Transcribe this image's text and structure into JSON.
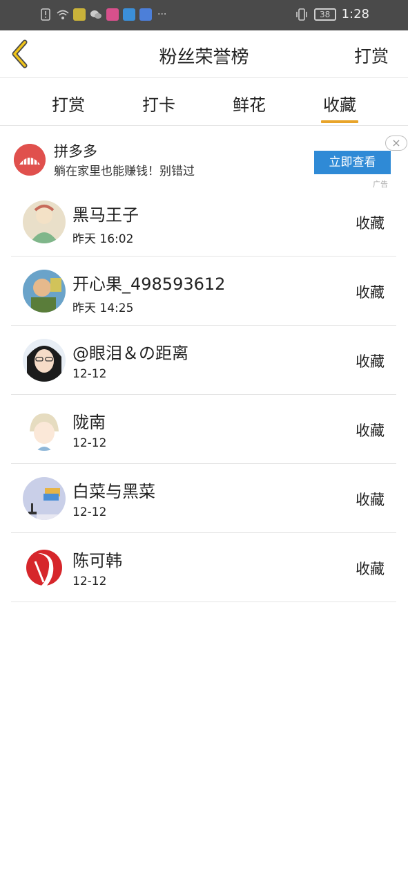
{
  "status_bar": {
    "time": "1:28",
    "battery": "38"
  },
  "header": {
    "title": "粉丝荣誉榜",
    "right_button": "打赏"
  },
  "tabs": [
    {
      "label": "打赏",
      "active": false
    },
    {
      "label": "打卡",
      "active": false
    },
    {
      "label": "鲜花",
      "active": false
    },
    {
      "label": "收藏",
      "active": true
    }
  ],
  "tab_accent": "#e8a42a",
  "ad": {
    "name": "拼多多",
    "description": "躺在家里也能赚钱！别错过",
    "cta": "立即查看",
    "tag": "广告",
    "cta_color": "#2f8ad6"
  },
  "fans": [
    {
      "name": "黑马王子",
      "time": "昨天 16:02",
      "action": "收藏"
    },
    {
      "name": "开心果_498593612",
      "time": "昨天 14:25",
      "action": "收藏"
    },
    {
      "name": "@眼泪＆の距离",
      "time": "12-12",
      "action": "收藏"
    },
    {
      "name": "陇南",
      "time": "12-12",
      "action": "收藏"
    },
    {
      "name": "白菜与黑菜",
      "time": "12-12",
      "action": "收藏"
    },
    {
      "name": "陈可韩",
      "time": "12-12",
      "action": "收藏"
    }
  ]
}
